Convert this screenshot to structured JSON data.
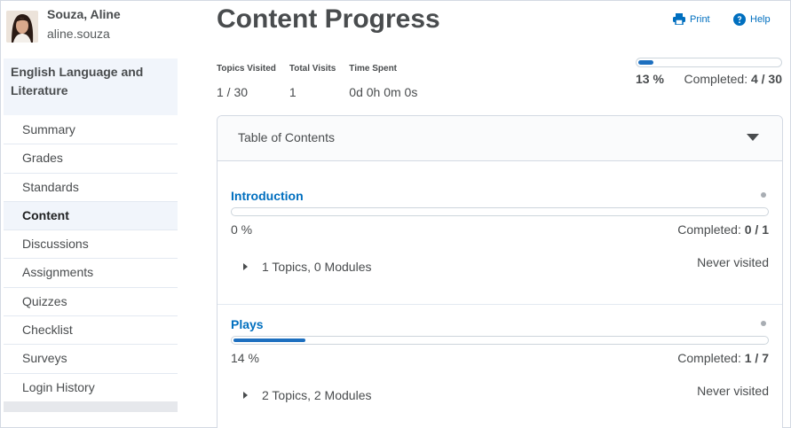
{
  "user": {
    "name": "Souza, Aline",
    "login": "aline.souza"
  },
  "course": {
    "title": "English Language and Literature"
  },
  "nav": [
    {
      "label": "Summary",
      "active": false
    },
    {
      "label": "Grades",
      "active": false
    },
    {
      "label": "Standards",
      "active": false
    },
    {
      "label": "Content",
      "active": true
    },
    {
      "label": "Discussions",
      "active": false
    },
    {
      "label": "Assignments",
      "active": false
    },
    {
      "label": "Quizzes",
      "active": false
    },
    {
      "label": "Checklist",
      "active": false
    },
    {
      "label": "Surveys",
      "active": false
    },
    {
      "label": "Login History",
      "active": false
    }
  ],
  "page": {
    "title": "Content Progress"
  },
  "tools": {
    "print_label": "Print",
    "help_label": "Help"
  },
  "stats": {
    "topics_visited_label": "Topics Visited",
    "topics_visited_value": "1 / 30",
    "total_visits_label": "Total Visits",
    "total_visits_value": "1",
    "time_spent_label": "Time Spent",
    "time_spent_value": "0d 0h 0m 0s"
  },
  "overall": {
    "percent_text": "13 %",
    "percent": 13,
    "completed_label": "Completed:",
    "completed_value": "4 / 30"
  },
  "toc": {
    "title": "Table of Contents",
    "modules": [
      {
        "name": "Introduction",
        "percent_text": "0 %",
        "percent": 0,
        "completed_label": "Completed:",
        "completed_value": "0 / 1",
        "summary": "1 Topics, 0 Modules",
        "visited": "Never visited"
      },
      {
        "name": "Plays",
        "percent_text": "14 %",
        "percent": 14,
        "completed_label": "Completed:",
        "completed_value": "1 / 7",
        "summary": "2 Topics, 2 Modules",
        "visited": "Never visited"
      }
    ]
  },
  "colors": {
    "accent": "#006fbf",
    "progress": "#1d6fbf",
    "nav_active_bg": "#f1f5fb"
  },
  "icons": {
    "print": "printer-icon",
    "help": "help-icon",
    "toc_toggle": "caret-down-icon",
    "module_expand": "caret-right-icon"
  }
}
